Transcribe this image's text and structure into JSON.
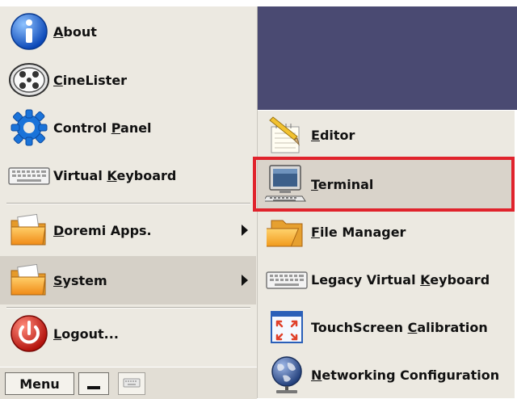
{
  "menu": {
    "items": [
      {
        "id": "about",
        "pre": "",
        "ul": "A",
        "post": "bout",
        "icon": "info-icon"
      },
      {
        "id": "cinelister",
        "pre": "",
        "ul": "C",
        "post": "ineLister",
        "icon": "film-reel-icon"
      },
      {
        "id": "control-panel",
        "pre": "Control ",
        "ul": "P",
        "post": "anel",
        "icon": "gear-icon"
      },
      {
        "id": "virtual-keyboard",
        "pre": "Virtual ",
        "ul": "K",
        "post": "eyboard",
        "icon": "keyboard-icon"
      },
      {
        "id": "doremi-apps",
        "pre": "",
        "ul": "D",
        "post": "oremi Apps.",
        "icon": "folder-icon"
      },
      {
        "id": "system",
        "pre": "",
        "ul": "S",
        "post": "ystem",
        "icon": "folder-icon"
      },
      {
        "id": "logout",
        "pre": "",
        "ul": "L",
        "post": "ogout...",
        "icon": "power-icon"
      }
    ]
  },
  "submenu": {
    "items": [
      {
        "id": "editor",
        "pre": "",
        "ul": "E",
        "post": "ditor",
        "icon": "pencil-icon"
      },
      {
        "id": "terminal",
        "pre": "",
        "ul": "T",
        "post": "erminal",
        "icon": "terminal-icon"
      },
      {
        "id": "file-manager",
        "pre": "",
        "ul": "F",
        "post": "ile Manager",
        "icon": "folder-icon"
      },
      {
        "id": "legacy-virtual-keyboard",
        "pre": "Legacy Virtual ",
        "ul": "K",
        "post": "eyboard",
        "icon": "keyboard-icon"
      },
      {
        "id": "touchscreen-calibration",
        "pre": "TouchScreen ",
        "ul": "C",
        "post": "alibration",
        "icon": "touchscreen-icon"
      },
      {
        "id": "networking-configuration",
        "pre": "",
        "ul": "N",
        "post": "etworking Configuration",
        "icon": "globe-icon"
      }
    ]
  },
  "taskbar": {
    "menu_label": "Menu"
  },
  "colors": {
    "desktop": "#4a4a72",
    "highlight_border": "#e0232c",
    "menu_bg": "#ece9e1"
  }
}
